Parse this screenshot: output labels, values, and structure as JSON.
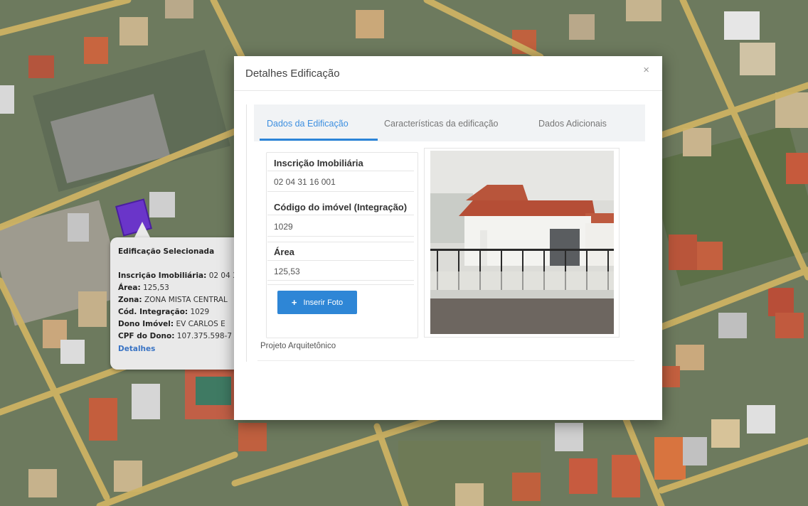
{
  "map_popup": {
    "title": "Edificação Selecionada",
    "rows": [
      {
        "label": "Inscrição Imobiliária:",
        "value": "02 04 3"
      },
      {
        "label": "Área:",
        "value": "125,53"
      },
      {
        "label": "Zona:",
        "value": "ZONA MISTA CENTRAL"
      },
      {
        "label": "Cód. Integração:",
        "value": "1029"
      },
      {
        "label": "Dono Imóvel:",
        "value": "EV CARLOS E"
      },
      {
        "label": "CPF do Dono:",
        "value": "107.375.598-7"
      }
    ],
    "link": "Detalhes"
  },
  "modal": {
    "title": "Detalhes Edificação",
    "close_icon": "close-icon",
    "tabs": [
      {
        "label": "Dados da Edificação",
        "active": true
      },
      {
        "label": "Características da edificação",
        "active": false
      },
      {
        "label": "Dados Adicionais",
        "active": false
      }
    ],
    "fields": [
      {
        "label": "Inscrição Imobiliária",
        "value": "02 04 31 16 001"
      },
      {
        "label": "Código do imóvel (Integração)",
        "value": "1029"
      },
      {
        "label": "Área",
        "value": "125,53"
      }
    ],
    "photo_button": {
      "icon": "plus-icon",
      "label": "Inserir Foto"
    },
    "section_label": "Projeto Arquitetônico"
  },
  "colors": {
    "accent": "#2e86d6",
    "active_tab": "#3d8fe0",
    "selected_building": "#6a35c9"
  }
}
